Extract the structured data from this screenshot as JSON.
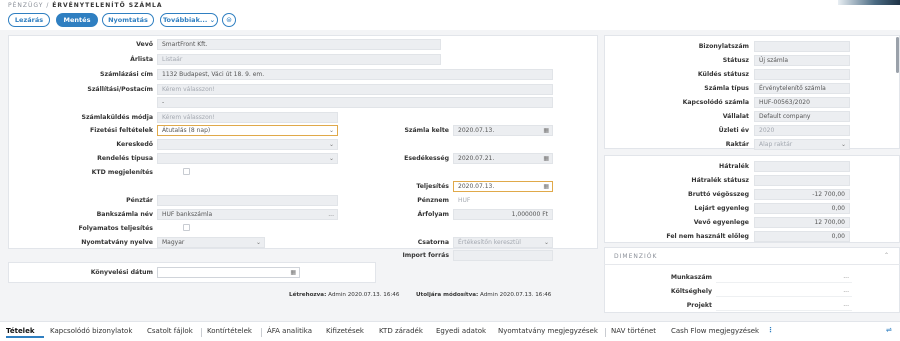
{
  "header": {
    "breadcrumb_parent": "PÉNZÜGY",
    "breadcrumb_separator": "/",
    "breadcrumb_title": "ÉRVÉNYTELENÍTŐ SZÁMLA"
  },
  "toolbar": {
    "lock": "Lezárás",
    "save": "Mentés",
    "print": "Nyomtatás",
    "more": "Továbbiak...",
    "more_chevron": "⌄",
    "history_icon": "⊜"
  },
  "left_form": {
    "buyer": {
      "label": "Vevő",
      "value": "SmartFront Kft."
    },
    "pricelist": {
      "label": "Árlista",
      "placeholder": "Listaár"
    },
    "billing_address": {
      "label": "Számlázási cím",
      "value": "1132 Budapest, Váci út 18. 9. em."
    },
    "shipping_address": {
      "label": "Szállítási/Postacím",
      "placeholder": "Kérem válasszon!",
      "extra": "-"
    },
    "invoice_delivery": {
      "label": "Számlaküldés módja",
      "placeholder": "Kérem válasszon!"
    },
    "payment_terms": {
      "label": "Fizetési feltételek",
      "value": "Átutalás (8 nap)",
      "chevron": "⌄"
    },
    "seller": {
      "label": "Kereskedő",
      "chevron": "⌄"
    },
    "order_type": {
      "label": "Rendelés típusa",
      "chevron": "⌄"
    },
    "ktd": {
      "label": "KTD megjelenítés"
    },
    "cashier": {
      "label": "Pénztár"
    },
    "bank_account": {
      "label": "Bankszámla név",
      "value": "HUF bankszámla",
      "dots": "..."
    },
    "continuous": {
      "label": "Folyamatos teljesítés"
    },
    "print_lang": {
      "label": "Nyomtatvány nyelve",
      "value": "Magyar",
      "chevron": "⌄"
    },
    "invoice_date": {
      "label": "Számla kelte",
      "value": "2020.07.13.",
      "icon": "▦"
    },
    "due_date": {
      "label": "Esedékesség",
      "value": "2020.07.21.",
      "icon": "▦"
    },
    "fulfillment": {
      "label": "Teljesítés",
      "value": "2020.07.13.",
      "icon": "▦"
    },
    "currency": {
      "label": "Pénznem",
      "value": "HUF"
    },
    "rate": {
      "label": "Árfolyam",
      "value": "1,000000 Ft"
    },
    "channel": {
      "label": "Csatorna",
      "value": "Értékesítőn keresztül",
      "chevron": "⌄"
    },
    "import_source": {
      "label": "Import forrás"
    },
    "booking_date": {
      "label": "Könyvelési dátum",
      "icon": "▦"
    }
  },
  "footer_meta": {
    "created_label": "Létrehozva:",
    "created_value": "Admin 2020.07.13. 16:46",
    "modified_label": "Utoljára módosítva:",
    "modified_value": "Admin 2020.07.13. 16:46"
  },
  "right_top": {
    "doc_number": {
      "label": "Bizonylatszám",
      "value": ""
    },
    "status": {
      "label": "Státusz",
      "value": "Új számla"
    },
    "send_status": {
      "label": "Küldés státusz",
      "value": ""
    },
    "invoice_type": {
      "label": "Számla típus",
      "value": "Érvénytelenítő számla"
    },
    "related_invoice": {
      "label": "Kapcsolódó számla",
      "value": "HUF-00563/2020"
    },
    "company": {
      "label": "Vállalat",
      "value": "Default company"
    },
    "fiscal_year": {
      "label": "Üzleti év",
      "value": "2020"
    },
    "warehouse": {
      "label": "Raktár",
      "value": "Alap raktár",
      "chevron": "⌄"
    }
  },
  "right_mid": {
    "arrears": {
      "label": "Hátralék",
      "value": ""
    },
    "arrears_status": {
      "label": "Hátralék státusz",
      "value": ""
    },
    "gross_total": {
      "label": "Bruttó végösszeg",
      "value": "-12 700,00"
    },
    "due_balance": {
      "label": "Lejárt egyenleg",
      "value": "0,00"
    },
    "customer_balance": {
      "label": "Vevő egyenlege",
      "value": "12 700,00"
    },
    "unused_advance": {
      "label": "Fel nem használt előleg",
      "value": "0,00"
    }
  },
  "dimensions": {
    "title": "DIMENZIÓK",
    "chevron": "⌃",
    "worksite": {
      "label": "Munkaszám",
      "dots": "..."
    },
    "cost_center": {
      "label": "Költséghely",
      "dots": "..."
    },
    "project": {
      "label": "Projekt",
      "dots": "..."
    }
  },
  "tabs": [
    "Tételek",
    "Kapcsolódó bizonylatok",
    "Csatolt fájlok",
    "Kontírtételek",
    "ÁFA analitika",
    "Kifizetések",
    "KTD záradék",
    "Egyedi adatok",
    "Nyomtatvány megjegyzések",
    "NAV történet",
    "Cash Flow megjegyzések"
  ],
  "tabs_more": "⋮",
  "tabs_right_icon": "⇌"
}
